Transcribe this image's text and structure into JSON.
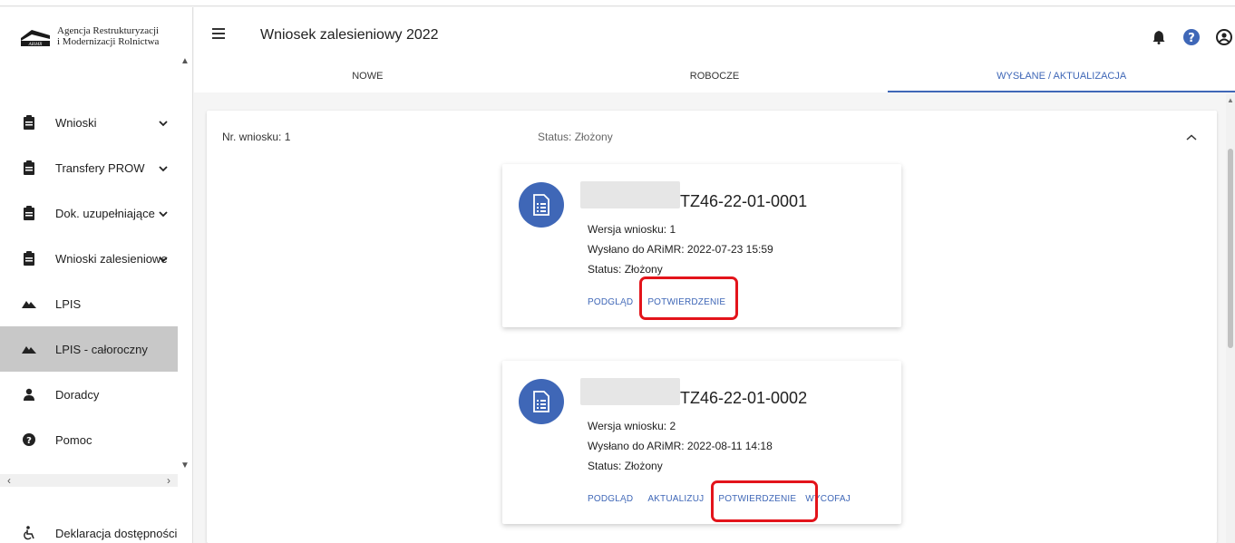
{
  "brand": {
    "logo_small_text": "ARiMR",
    "line1": "Agencja Restrukturyzacji",
    "line2": "i Modernizacji Rolnictwa"
  },
  "header": {
    "title": "Wniosek zalesieniowy 2022",
    "icons": [
      "bell-icon",
      "help-icon",
      "account-icon"
    ]
  },
  "tabs": [
    {
      "label": "NOWE",
      "active": false
    },
    {
      "label": "ROBOCZE",
      "active": false
    },
    {
      "label": "WYSŁANE / AKTUALIZACJA",
      "active": true
    }
  ],
  "sidebar": {
    "items": [
      {
        "label": "Wnioski",
        "icon": "clipboard-icon",
        "expandable": true
      },
      {
        "label": "Transfery PROW",
        "icon": "clipboard-icon",
        "expandable": true
      },
      {
        "label": "Dok. uzupełniające",
        "icon": "clipboard-icon",
        "expandable": true
      },
      {
        "label": "Wnioski zalesieniowe",
        "icon": "clipboard-icon",
        "expandable": true
      },
      {
        "label": "LPIS",
        "icon": "terrain-icon",
        "expandable": false
      },
      {
        "label": "LPIS - całoroczny",
        "icon": "terrain-icon",
        "expandable": false,
        "active": true
      },
      {
        "label": "Doradcy",
        "icon": "person-icon",
        "expandable": false
      },
      {
        "label": "Pomoc",
        "icon": "help-icon",
        "expandable": false
      }
    ],
    "declaration": "Deklaracja dostępności"
  },
  "group": {
    "nr_label": "Nr. wniosku: 1",
    "status_label": "Status: Złożony"
  },
  "cards": [
    {
      "number": "TZ46-22-01-0001",
      "version": "Wersja wniosku: 1",
      "sent": "Wysłano do ARiMR: 2022-07-23 15:59",
      "status": "Status: Złożony",
      "actions": [
        "PODGLĄD",
        "POTWIERDZENIE"
      ]
    },
    {
      "number": "TZ46-22-01-0002",
      "version": "Wersja wniosku: 2",
      "sent": "Wysłano do ARiMR: 2022-08-11 14:18",
      "status": "Status: Złożony",
      "actions": [
        "PODGLĄD",
        "AKTUALIZUJ",
        "POTWIERDZENIE",
        "WYCOFAJ"
      ]
    }
  ],
  "colors": {
    "accent": "#3f67b7",
    "highlight": "#e3141b",
    "active_nav": "#c8c8c8"
  }
}
